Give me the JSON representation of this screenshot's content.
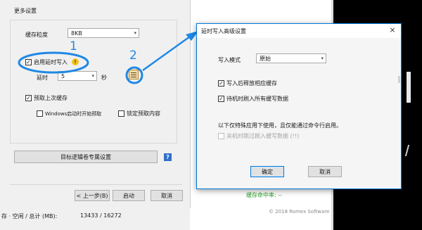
{
  "left_panel": {
    "section_title": "更多设置",
    "cache_granularity_label": "缓存粒度",
    "cache_granularity_value": "8KB",
    "enable_deferred_write_label": "启用延时写入",
    "delay_label": "延时",
    "delay_value": "5",
    "delay_unit": "秒",
    "prefetch_last_cache_label": "预取上次缓存",
    "windows_startup_prefetch_label": "Windows启动时开始预取",
    "lock_prefetch_label": "锁定预取内容",
    "target_volume_button": "目标逻辑卷专属设置",
    "help_label": "?",
    "back_button": "< 上一步(B)",
    "start_button": "启动",
    "cancel_button": "取消",
    "status_text": "存 · 空闲 / 总计 (MB):",
    "status_values": "13433 / 16272"
  },
  "annotations": {
    "marker_1": "1",
    "marker_2": "2"
  },
  "dialog": {
    "title": "延时写入高级设置",
    "close_glyph": "×",
    "write_mode_label": "写入模式",
    "write_mode_value": "原始",
    "free_cache_after_write_label": "写入后释放相应缓存",
    "flush_on_idle_label": "待机时刷入所有缓写数据",
    "note_text": "以下仅特殊应用下使用，且仅能通过命令行启用。",
    "flush_on_shutdown_label": "关机时跳过刷入缓写数据 (!!)",
    "ok_button": "确定",
    "cancel_button": "取消"
  },
  "background": {
    "green_status": "缓存命中率: --",
    "copyright": "© 2018 Romex Software"
  },
  "colors": {
    "annotation_blue": "#1e88e5",
    "green_text": "#2e9d2e",
    "dialog_accent": "#0078d7"
  },
  "icons": [
    "check-icon",
    "warning-icon",
    "advanced-settings-icon",
    "help-icon",
    "close-icon",
    "chevron-down-icon"
  ]
}
